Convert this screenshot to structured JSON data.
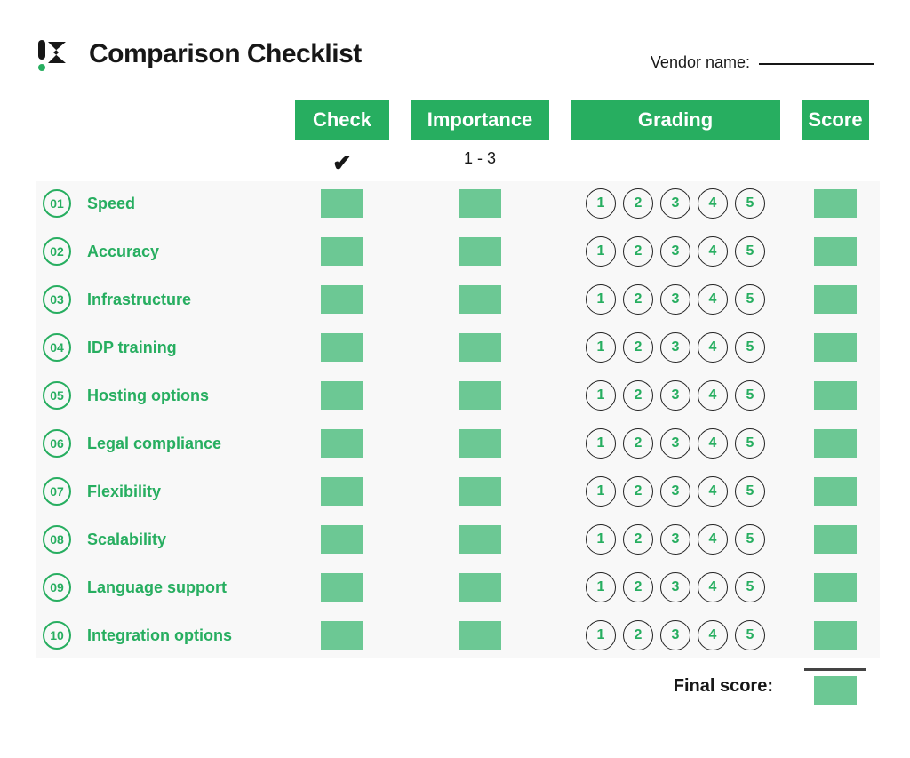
{
  "title": "Comparison Checklist",
  "vendor": {
    "label": "Vendor name:",
    "value": ""
  },
  "columns": {
    "check": "Check",
    "importance": "Importance",
    "grading": "Grading",
    "score": "Score"
  },
  "subheads": {
    "check": "✔",
    "importance": "1 - 3"
  },
  "grade_scale": [
    1,
    2,
    3,
    4,
    5
  ],
  "criteria": [
    {
      "num": "01",
      "label": "Speed"
    },
    {
      "num": "02",
      "label": "Accuracy"
    },
    {
      "num": "03",
      "label": "Infrastructure"
    },
    {
      "num": "04",
      "label": "IDP training"
    },
    {
      "num": "05",
      "label": "Hosting options"
    },
    {
      "num": "06",
      "label": "Legal compliance"
    },
    {
      "num": "07",
      "label": "Flexibility"
    },
    {
      "num": "08",
      "label": "Scalability"
    },
    {
      "num": "09",
      "label": "Language support"
    },
    {
      "num": "10",
      "label": "Integration options"
    }
  ],
  "final": {
    "label": "Final score:"
  }
}
